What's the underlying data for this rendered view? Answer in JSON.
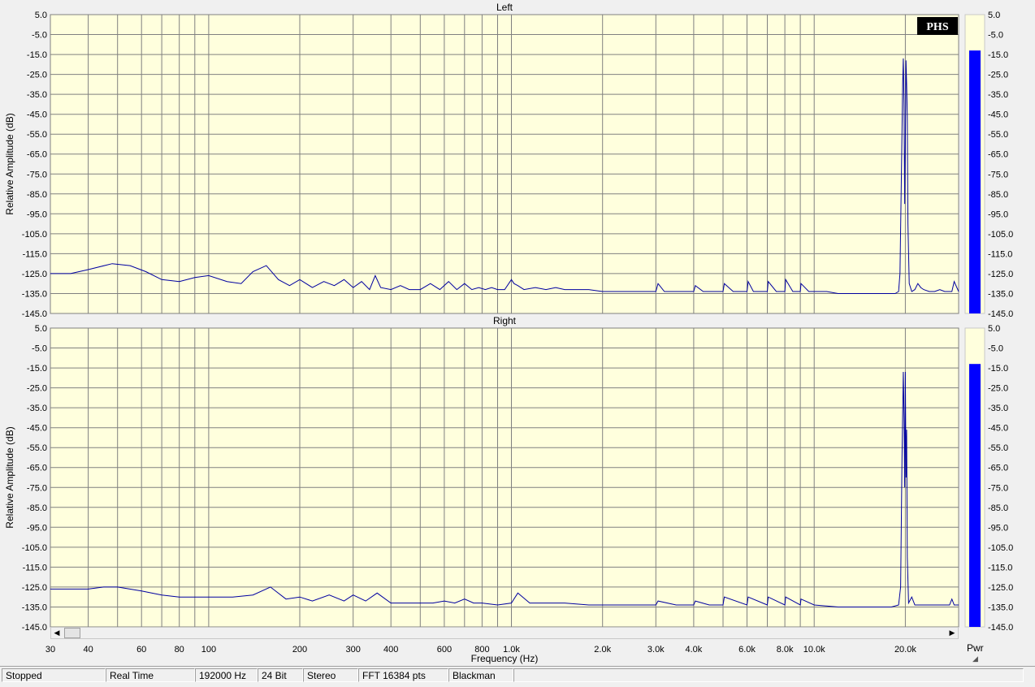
{
  "chart_data": [
    {
      "type": "line",
      "title": "Left",
      "xlabel": "Frequency (Hz)",
      "ylabel": "Relative Amplitude (dB)",
      "xscale": "log",
      "xlim": [
        30,
        30000
      ],
      "ylim": [
        -145,
        5
      ],
      "grid": true,
      "yticks": [
        "5.0",
        "-5.0",
        "-15.0",
        "-25.0",
        "-35.0",
        "-45.0",
        "-55.0",
        "-65.0",
        "-75.0",
        "-85.0",
        "-95.0",
        "-105.0",
        "-115.0",
        "-125.0",
        "-135.0",
        "-145.0"
      ],
      "series": [
        {
          "color": "#0000a0",
          "x": [
            30,
            35,
            40,
            48,
            55,
            62,
            70,
            80,
            90,
            100,
            115,
            128,
            140,
            155,
            170,
            185,
            200,
            220,
            240,
            260,
            280,
            300,
            320,
            340,
            355,
            370,
            400,
            430,
            460,
            500,
            540,
            580,
            620,
            660,
            700,
            740,
            780,
            820,
            860,
            900,
            950,
            990,
            1000,
            1020,
            1050,
            1100,
            1200,
            1300,
            1400,
            1500,
            1600,
            1800,
            2000,
            2200,
            2500,
            2800,
            3000,
            3050,
            3200,
            3500,
            3900,
            4000,
            4050,
            4300,
            4700,
            5000,
            5050,
            5400,
            5800,
            6000,
            6050,
            6300,
            6700,
            7000,
            7050,
            7500,
            8000,
            8050,
            8500,
            9000,
            9050,
            9600,
            10000,
            10500,
            11000,
            12000,
            13000,
            14000,
            15000,
            16000,
            17500,
            18500,
            19000,
            19200,
            19400,
            19600,
            19700,
            19800,
            19900,
            20000,
            20100,
            20200,
            20300,
            20400,
            20600,
            21000,
            21500,
            22000,
            22500,
            23000,
            24000,
            25000,
            26000,
            27000,
            28000,
            28500,
            29000,
            30000
          ],
          "y": [
            -125,
            -125,
            -123,
            -120,
            -121,
            -124,
            -128,
            -129,
            -127,
            -126,
            -129,
            -130,
            -124,
            -121,
            -128,
            -131,
            -128,
            -132,
            -129,
            -131,
            -128,
            -132,
            -129,
            -133,
            -126,
            -132,
            -133,
            -131,
            -133,
            -133,
            -130,
            -133,
            -129,
            -133,
            -130,
            -133,
            -132,
            -133,
            -132,
            -133,
            -133,
            -129,
            -128,
            -130,
            -131,
            -133,
            -132,
            -133,
            -132,
            -133,
            -133,
            -133,
            -134,
            -134,
            -134,
            -134,
            -134,
            -130,
            -134,
            -134,
            -134,
            -134,
            -131,
            -134,
            -134,
            -134,
            -130,
            -134,
            -134,
            -134,
            -129,
            -134,
            -134,
            -134,
            -129,
            -134,
            -134,
            -128,
            -134,
            -134,
            -130,
            -134,
            -134,
            -134,
            -134,
            -135,
            -135,
            -135,
            -135,
            -135,
            -135,
            -135,
            -134,
            -125,
            -80,
            -30,
            -17,
            -40,
            -90,
            -60,
            -18,
            -30,
            -46,
            -100,
            -130,
            -134,
            -133,
            -130,
            -132,
            -133,
            -134,
            -134,
            -133,
            -134,
            -134,
            -134,
            -129,
            -134
          ]
        }
      ]
    },
    {
      "type": "line",
      "title": "Right",
      "xlabel": "Frequency (Hz)",
      "ylabel": "Relative Amplitude (dB)",
      "xscale": "log",
      "xlim": [
        30,
        30000
      ],
      "ylim": [
        -145,
        5
      ],
      "grid": true,
      "yticks": [
        "5.0",
        "-5.0",
        "-15.0",
        "-25.0",
        "-35.0",
        "-45.0",
        "-55.0",
        "-65.0",
        "-75.0",
        "-85.0",
        "-95.0",
        "-105.0",
        "-115.0",
        "-125.0",
        "-135.0",
        "-145.0"
      ],
      "series": [
        {
          "color": "#0000a0",
          "x": [
            30,
            35,
            40,
            45,
            50,
            60,
            70,
            80,
            90,
            100,
            120,
            140,
            160,
            180,
            200,
            220,
            250,
            280,
            300,
            330,
            360,
            400,
            450,
            500,
            550,
            600,
            650,
            700,
            750,
            800,
            900,
            1000,
            1050,
            1150,
            1300,
            1500,
            1800,
            2000,
            2500,
            3000,
            3050,
            3500,
            4000,
            4050,
            4500,
            5000,
            5050,
            6000,
            6050,
            7000,
            7050,
            8000,
            8050,
            9000,
            9050,
            10000,
            12000,
            14000,
            16000,
            18000,
            19000,
            19300,
            19500,
            19700,
            19800,
            19900,
            20000,
            20100,
            20200,
            20300,
            20500,
            21000,
            21500,
            22000,
            24000,
            26000,
            28000,
            28500,
            29000,
            30000
          ],
          "y": [
            -126,
            -126,
            -126,
            -125,
            -125,
            -127,
            -129,
            -130,
            -130,
            -130,
            -130,
            -129,
            -125,
            -131,
            -130,
            -132,
            -129,
            -132,
            -129,
            -132,
            -128,
            -133,
            -133,
            -133,
            -133,
            -132,
            -133,
            -131,
            -133,
            -133,
            -134,
            -133,
            -128,
            -133,
            -133,
            -133,
            -134,
            -134,
            -134,
            -134,
            -132,
            -134,
            -134,
            -132,
            -134,
            -134,
            -130,
            -134,
            -130,
            -134,
            -130,
            -134,
            -130,
            -134,
            -131,
            -134,
            -135,
            -135,
            -135,
            -135,
            -134,
            -125,
            -60,
            -17,
            -40,
            -75,
            -17,
            -70,
            -46,
            -110,
            -133,
            -130,
            -134,
            -134,
            -134,
            -134,
            -134,
            -131,
            -134,
            -134
          ]
        }
      ]
    }
  ],
  "xticks": [
    {
      "v": 30,
      "label": "30"
    },
    {
      "v": 40,
      "label": "40"
    },
    {
      "v": 60,
      "label": "60"
    },
    {
      "v": 80,
      "label": "80"
    },
    {
      "v": 100,
      "label": "100"
    },
    {
      "v": 200,
      "label": "200"
    },
    {
      "v": 300,
      "label": "300"
    },
    {
      "v": 400,
      "label": "400"
    },
    {
      "v": 600,
      "label": "600"
    },
    {
      "v": 800,
      "label": "800"
    },
    {
      "v": 1000,
      "label": "1.0k"
    },
    {
      "v": 2000,
      "label": "2.0k"
    },
    {
      "v": 3000,
      "label": "3.0k"
    },
    {
      "v": 4000,
      "label": "4.0k"
    },
    {
      "v": 6000,
      "label": "6.0k"
    },
    {
      "v": 8000,
      "label": "8.0k"
    },
    {
      "v": 10000,
      "label": "10.0k"
    },
    {
      "v": 20000,
      "label": "20.0k"
    }
  ],
  "gridlines_x": [
    30,
    40,
    50,
    60,
    70,
    80,
    90,
    100,
    200,
    300,
    400,
    500,
    600,
    700,
    800,
    900,
    1000,
    2000,
    3000,
    4000,
    5000,
    6000,
    7000,
    8000,
    9000,
    10000,
    20000
  ],
  "meters": {
    "label": "Pwr",
    "left_level_db": -13,
    "right_level_db": -13,
    "scale_min_db": -145,
    "scale_max_db": 5,
    "fill_color": "#0000ff"
  },
  "logo": "PHS",
  "colors": {
    "plot_bg": "#ffffdd",
    "grid": "#808080",
    "trace": "#0000a0"
  },
  "status": {
    "state": "Stopped",
    "mode": "Real Time",
    "sample_rate": "192000 Hz",
    "bits": "24 Bit",
    "channels": "Stereo",
    "fft": "FFT 16384 pts",
    "window": "Blackman"
  },
  "scrollbar": {
    "left_arrow": "◀",
    "right_arrow": "▶"
  }
}
